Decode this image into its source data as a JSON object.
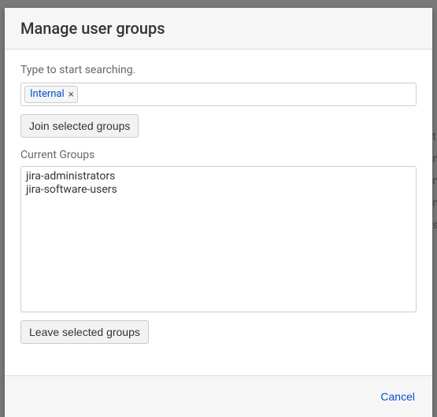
{
  "modal": {
    "title": "Manage user groups",
    "hint": "Type to start searching.",
    "selected_tags": [
      {
        "label": "Internal"
      }
    ],
    "join_button": "Join selected groups",
    "current_groups_label": "Current Groups",
    "current_groups": [
      "jira-administrators",
      "jira-software-users"
    ],
    "leave_button": "Leave selected groups",
    "cancel": "Cancel"
  }
}
